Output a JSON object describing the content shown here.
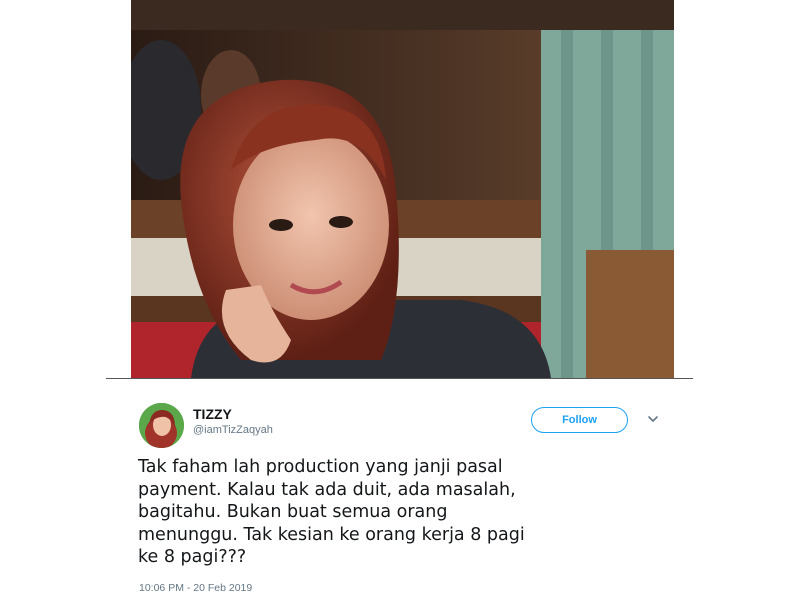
{
  "photo": {
    "description_icon": "profile-photo"
  },
  "tweet": {
    "user": {
      "display_name": "TIZZY",
      "handle": "@iamTizZaqyah"
    },
    "follow_label": "Follow",
    "text": "Tak faham lah production yang janji pasal\npayment. Kalau tak ada duit, ada masalah,\nbagitahu. Bukan buat semua orang\nmenunggu. Tak kesian ke orang kerja 8 pagi\nke 8 pagi???",
    "timestamp": "10:06 PM - 20 Feb 2019"
  },
  "colors": {
    "accent": "#1da1f2",
    "text": "#14171a",
    "secondary": "#657786"
  }
}
